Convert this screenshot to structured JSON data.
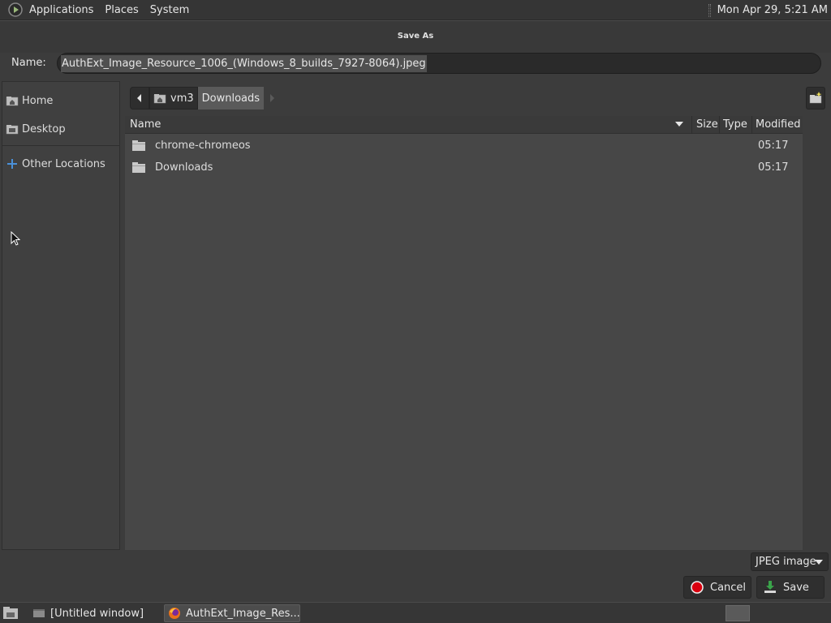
{
  "top_panel": {
    "menus": [
      "Applications",
      "Places",
      "System"
    ],
    "clock": "Mon Apr 29,  5:21 AM"
  },
  "dialog": {
    "title": "Save As",
    "name_label": "Name:",
    "name_value": "AuthExt_Image_Resource_1006_(Windows_8_builds_7927-8064).jpeg"
  },
  "sidebar": {
    "items": [
      {
        "label": "Home",
        "icon": "home-folder-icon"
      },
      {
        "label": "Desktop",
        "icon": "desktop-folder-icon"
      },
      {
        "label": "Other Locations",
        "icon": "plus-icon"
      }
    ]
  },
  "pathbar": {
    "segments": [
      "vm3",
      "Downloads"
    ],
    "active": "Downloads"
  },
  "filelist": {
    "columns": {
      "name": "Name",
      "size": "Size",
      "type": "Type",
      "modified": "Modified"
    },
    "rows": [
      {
        "name": "chrome-chromeos",
        "size": "",
        "type": "",
        "modified": "05:17"
      },
      {
        "name": "Downloads",
        "size": "",
        "type": "",
        "modified": "05:17"
      }
    ]
  },
  "filter": {
    "selected": "JPEG image"
  },
  "buttons": {
    "cancel": "Cancel",
    "save": "Save"
  },
  "taskbar": {
    "tasks": [
      "[Untitled window]",
      "AuthExt_Image_Res..."
    ]
  },
  "colors": {
    "panel": "#353535",
    "list_bg": "#474747",
    "accent_red": "#d9000f",
    "save_green": "#3aa34a"
  }
}
